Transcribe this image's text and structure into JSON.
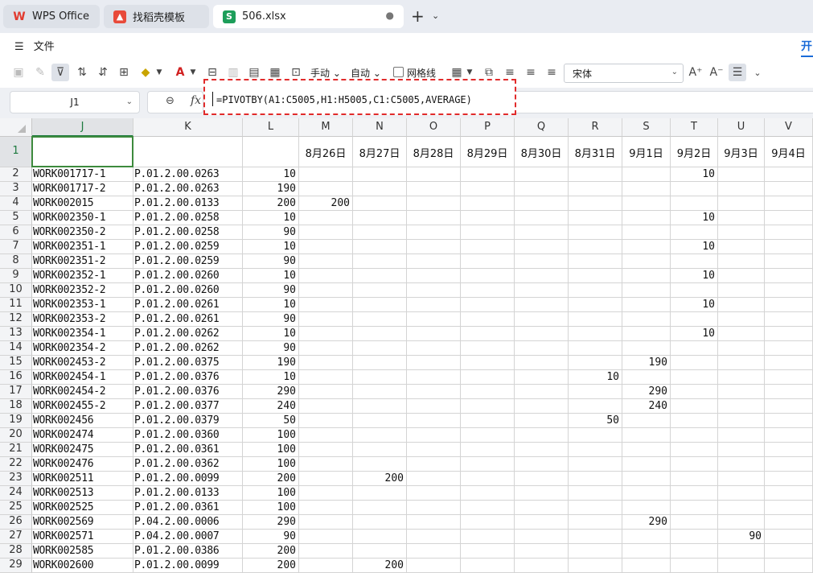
{
  "tabs": [
    {
      "label": "WPS Office",
      "icon": "wps-logo-icon"
    },
    {
      "label": "找稻壳模板",
      "icon": "template-logo-icon"
    },
    {
      "label": "506.xlsx",
      "icon": "spreadsheet-logo-icon"
    }
  ],
  "menu": {
    "file_label": "文件",
    "start_tab": "开"
  },
  "toolbar": {
    "manual_label": "手动",
    "auto_label": "自动",
    "gridlines_label": "网格线",
    "font_name": "宋体"
  },
  "formula_bar": {
    "name_box": "J1",
    "fx_label": "fx",
    "formula": "=PIVOTBY(A1:C5005,H1:H5005,C1:C5005,AVERAGE)"
  },
  "sheet": {
    "columns": [
      "J",
      "K",
      "L",
      "M",
      "N",
      "O",
      "P",
      "Q",
      "R",
      "S",
      "T",
      "U",
      "V"
    ],
    "header_row": [
      "",
      "",
      "",
      "8月26日",
      "8月27日",
      "8月28日",
      "8月29日",
      "8月30日",
      "8月31日",
      "9月1日",
      "9月2日",
      "9月3日",
      "9月4日"
    ],
    "rows": [
      {
        "n": "2",
        "J": "WORK001717-1",
        "K": "P.01.2.00.0263",
        "L": "10",
        "M": "",
        "N": "",
        "R": "",
        "S": "",
        "T": "10",
        "U": ""
      },
      {
        "n": "3",
        "J": "WORK001717-2",
        "K": "P.01.2.00.0263",
        "L": "190",
        "M": "",
        "N": "",
        "R": "",
        "S": "",
        "T": "",
        "U": ""
      },
      {
        "n": "4",
        "J": "WORK002015",
        "K": "P.01.2.00.0133",
        "L": "200",
        "M": "200",
        "N": "",
        "R": "",
        "S": "",
        "T": "",
        "U": ""
      },
      {
        "n": "5",
        "J": "WORK002350-1",
        "K": "P.01.2.00.0258",
        "L": "10",
        "M": "",
        "N": "",
        "R": "",
        "S": "",
        "T": "10",
        "U": ""
      },
      {
        "n": "6",
        "J": "WORK002350-2",
        "K": "P.01.2.00.0258",
        "L": "90",
        "M": "",
        "N": "",
        "R": "",
        "S": "",
        "T": "",
        "U": ""
      },
      {
        "n": "7",
        "J": "WORK002351-1",
        "K": "P.01.2.00.0259",
        "L": "10",
        "M": "",
        "N": "",
        "R": "",
        "S": "",
        "T": "10",
        "U": ""
      },
      {
        "n": "8",
        "J": "WORK002351-2",
        "K": "P.01.2.00.0259",
        "L": "90",
        "M": "",
        "N": "",
        "R": "",
        "S": "",
        "T": "",
        "U": ""
      },
      {
        "n": "9",
        "J": "WORK002352-1",
        "K": "P.01.2.00.0260",
        "L": "10",
        "M": "",
        "N": "",
        "R": "",
        "S": "",
        "T": "10",
        "U": ""
      },
      {
        "n": "10",
        "J": "WORK002352-2",
        "K": "P.01.2.00.0260",
        "L": "90",
        "M": "",
        "N": "",
        "R": "",
        "S": "",
        "T": "",
        "U": ""
      },
      {
        "n": "11",
        "J": "WORK002353-1",
        "K": "P.01.2.00.0261",
        "L": "10",
        "M": "",
        "N": "",
        "R": "",
        "S": "",
        "T": "10",
        "U": ""
      },
      {
        "n": "12",
        "J": "WORK002353-2",
        "K": "P.01.2.00.0261",
        "L": "90",
        "M": "",
        "N": "",
        "R": "",
        "S": "",
        "T": "",
        "U": ""
      },
      {
        "n": "13",
        "J": "WORK002354-1",
        "K": "P.01.2.00.0262",
        "L": "10",
        "M": "",
        "N": "",
        "R": "",
        "S": "",
        "T": "10",
        "U": ""
      },
      {
        "n": "14",
        "J": "WORK002354-2",
        "K": "P.01.2.00.0262",
        "L": "90",
        "M": "",
        "N": "",
        "R": "",
        "S": "",
        "T": "",
        "U": ""
      },
      {
        "n": "15",
        "J": "WORK002453-2",
        "K": "P.01.2.00.0375",
        "L": "190",
        "M": "",
        "N": "",
        "R": "",
        "S": "190",
        "T": "",
        "U": ""
      },
      {
        "n": "16",
        "J": "WORK002454-1",
        "K": "P.01.2.00.0376",
        "L": "10",
        "M": "",
        "N": "",
        "R": "10",
        "S": "",
        "T": "",
        "U": ""
      },
      {
        "n": "17",
        "J": "WORK002454-2",
        "K": "P.01.2.00.0376",
        "L": "290",
        "M": "",
        "N": "",
        "R": "",
        "S": "290",
        "T": "",
        "U": ""
      },
      {
        "n": "18",
        "J": "WORK002455-2",
        "K": "P.01.2.00.0377",
        "L": "240",
        "M": "",
        "N": "",
        "R": "",
        "S": "240",
        "T": "",
        "U": ""
      },
      {
        "n": "19",
        "J": "WORK002456",
        "K": "P.01.2.00.0379",
        "L": "50",
        "M": "",
        "N": "",
        "R": "50",
        "S": "",
        "T": "",
        "U": ""
      },
      {
        "n": "20",
        "J": "WORK002474",
        "K": "P.01.2.00.0360",
        "L": "100",
        "M": "",
        "N": "",
        "R": "",
        "S": "",
        "T": "",
        "U": ""
      },
      {
        "n": "21",
        "J": "WORK002475",
        "K": "P.01.2.00.0361",
        "L": "100",
        "M": "",
        "N": "",
        "R": "",
        "S": "",
        "T": "",
        "U": ""
      },
      {
        "n": "22",
        "J": "WORK002476",
        "K": "P.01.2.00.0362",
        "L": "100",
        "M": "",
        "N": "",
        "R": "",
        "S": "",
        "T": "",
        "U": ""
      },
      {
        "n": "23",
        "J": "WORK002511",
        "K": "P.01.2.00.0099",
        "L": "200",
        "M": "",
        "N": "200",
        "R": "",
        "S": "",
        "T": "",
        "U": ""
      },
      {
        "n": "24",
        "J": "WORK002513",
        "K": "P.01.2.00.0133",
        "L": "100",
        "M": "",
        "N": "",
        "R": "",
        "S": "",
        "T": "",
        "U": ""
      },
      {
        "n": "25",
        "J": "WORK002525",
        "K": "P.01.2.00.0361",
        "L": "100",
        "M": "",
        "N": "",
        "R": "",
        "S": "",
        "T": "",
        "U": ""
      },
      {
        "n": "26",
        "J": "WORK002569",
        "K": "P.04.2.00.0006",
        "L": "290",
        "M": "",
        "N": "",
        "R": "",
        "S": "290",
        "T": "",
        "U": ""
      },
      {
        "n": "27",
        "J": "WORK002571",
        "K": "P.04.2.00.0007",
        "L": "90",
        "M": "",
        "N": "",
        "R": "",
        "S": "",
        "T": "",
        "U": "90"
      },
      {
        "n": "28",
        "J": "WORK002585",
        "K": "P.01.2.00.0386",
        "L": "200",
        "M": "",
        "N": "",
        "R": "",
        "S": "",
        "T": "",
        "U": ""
      },
      {
        "n": "29",
        "J": "WORK002600",
        "K": "P.01.2.00.0099",
        "L": "200",
        "M": "",
        "N": "200",
        "R": "",
        "S": "",
        "T": "",
        "U": ""
      }
    ]
  },
  "colors": {
    "accent_green": "#1d7a3f",
    "annotation_red": "#e12b2b",
    "start_tab_blue": "#1a6bd8"
  }
}
